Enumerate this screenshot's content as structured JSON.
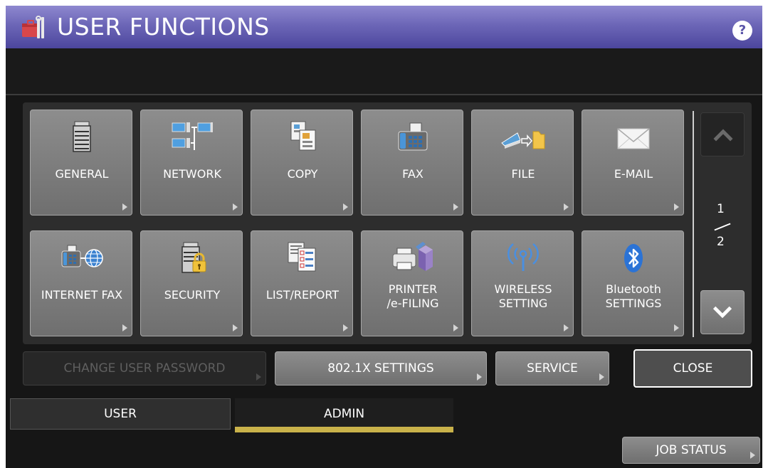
{
  "header": {
    "title": "USER FUNCTIONS",
    "title_icon": "toolbox-icon",
    "help_label": "?"
  },
  "functions": [
    {
      "label": "GENERAL",
      "icon": "copier-icon"
    },
    {
      "label": "NETWORK",
      "icon": "network-computers-icon"
    },
    {
      "label": "COPY",
      "icon": "copy-documents-icon"
    },
    {
      "label": "FAX",
      "icon": "fax-machine-icon"
    },
    {
      "label": "FILE",
      "icon": "scan-to-folder-icon"
    },
    {
      "label": "E-MAIL",
      "icon": "envelope-icon"
    },
    {
      "label": "INTERNET FAX",
      "icon": "fax-globe-icon"
    },
    {
      "label": "SECURITY",
      "icon": "copier-lock-icon"
    },
    {
      "label": "LIST/REPORT",
      "icon": "report-checklist-icon"
    },
    {
      "label": "PRINTER\n/e-FILING",
      "icon": "printer-box-icon"
    },
    {
      "label": "WIRELESS\nSETTING",
      "icon": "wireless-antenna-icon"
    },
    {
      "label": "Bluetooth\nSETTINGS",
      "icon": "bluetooth-icon"
    }
  ],
  "pagination": {
    "current": "1",
    "total": "2"
  },
  "bottom_buttons": {
    "change_password": "CHANGE USER PASSWORD",
    "dot1x": "802.1X SETTINGS",
    "service": "SERVICE",
    "close": "CLOSE"
  },
  "tabs": {
    "user": "USER",
    "admin": "ADMIN",
    "active": "ADMIN"
  },
  "footer": {
    "job_status": "JOB STATUS"
  },
  "colors": {
    "title_bar": "#6c66b7",
    "button_gray": "#7f7f7f",
    "active_tab_accent": "#c9b24a",
    "background": "#161616"
  }
}
